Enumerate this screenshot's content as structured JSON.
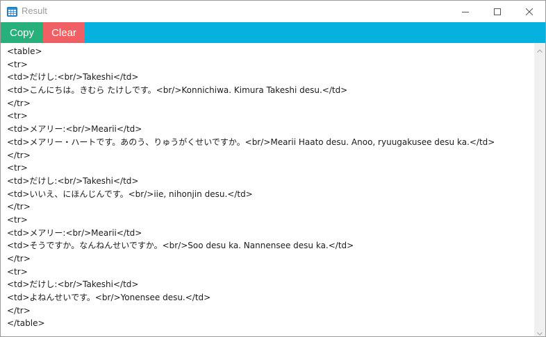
{
  "window": {
    "title": "Result"
  },
  "toolbar": {
    "copy_label": "Copy",
    "clear_label": "Clear"
  },
  "colors": {
    "toolbar_bg": "#06b1e0",
    "copy_bg": "#27b07a",
    "clear_bg": "#ef5f63"
  },
  "icons": {
    "app": "table-icon",
    "minimize": "minimize-icon",
    "maximize": "maximize-icon",
    "close": "close-icon"
  },
  "content": {
    "lines": [
      "<table>",
      "<tr>",
      "<td>だけし:<br/>Takeshi</td>",
      "<td>こんにちは。きむら たけしです。<br/>Konnichiwa. Kimura Takeshi desu.</td>",
      "</tr>",
      "<tr>",
      "<td>メアリー:<br/>Mearii</td>",
      "<td>メアリー・ハートです。あのう、りゅうがくせいですか。<br/>Mearii Haato desu. Anoo, ryuugakusee desu ka.</td>",
      "</tr>",
      "<tr>",
      "<td>だけし:<br/>Takeshi</td>",
      "<td>いいえ、にほんじんです。<br/>iie, nihonjin desu.</td>",
      "</tr>",
      "<tr>",
      "<td>メアリー:<br/>Mearii</td>",
      "<td>そうですか。なんねんせいですか。<br/>Soo desu ka. Nannensee desu ka.</td>",
      "</tr>",
      "<tr>",
      "<td>だけし:<br/>Takeshi</td>",
      "<td>よねんせいです。<br/>Yonensee desu.</td>",
      "</tr>",
      "</table>"
    ]
  }
}
